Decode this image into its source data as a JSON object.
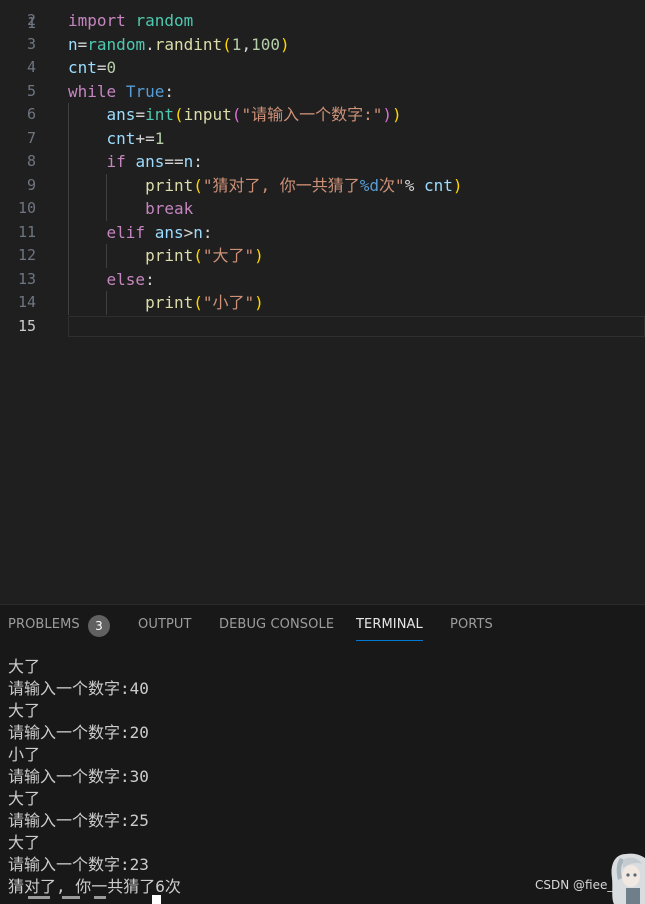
{
  "editor": {
    "top_line_number": "1",
    "active_line": "15",
    "lines": [
      {
        "num": "2",
        "tokens": [
          [
            "kw-ctl",
            "import"
          ],
          [
            "op",
            " "
          ],
          [
            "mod",
            "random"
          ]
        ]
      },
      {
        "num": "3",
        "tokens": [
          [
            "var",
            "n"
          ],
          [
            "op",
            "="
          ],
          [
            "mod",
            "random"
          ],
          [
            "op",
            "."
          ],
          [
            "fn",
            "randint"
          ],
          [
            "p1",
            "("
          ],
          [
            "num",
            "1"
          ],
          [
            "op",
            ","
          ],
          [
            "num",
            "100"
          ],
          [
            "p1",
            ")"
          ]
        ]
      },
      {
        "num": "4",
        "tokens": [
          [
            "var",
            "cnt"
          ],
          [
            "op",
            "="
          ],
          [
            "num",
            "0"
          ]
        ]
      },
      {
        "num": "5",
        "tokens": [
          [
            "kw-ctl",
            "while"
          ],
          [
            "op",
            " "
          ],
          [
            "kw",
            "True"
          ],
          [
            "op",
            ":"
          ]
        ]
      },
      {
        "num": "6",
        "tokens": [
          [
            "op",
            "    "
          ],
          [
            "var",
            "ans"
          ],
          [
            "op",
            "="
          ],
          [
            "mod",
            "int"
          ],
          [
            "p1",
            "("
          ],
          [
            "fn",
            "input"
          ],
          [
            "p2",
            "("
          ],
          [
            "str",
            "\"请输入一个数字:\""
          ],
          [
            "p2",
            ")"
          ],
          [
            "p1",
            ")"
          ]
        ]
      },
      {
        "num": "7",
        "tokens": [
          [
            "op",
            "    "
          ],
          [
            "var",
            "cnt"
          ],
          [
            "op",
            "+="
          ],
          [
            "num",
            "1"
          ]
        ]
      },
      {
        "num": "8",
        "tokens": [
          [
            "op",
            "    "
          ],
          [
            "kw-ctl",
            "if"
          ],
          [
            "op",
            " "
          ],
          [
            "var",
            "ans"
          ],
          [
            "op",
            "=="
          ],
          [
            "var",
            "n"
          ],
          [
            "op",
            ":"
          ]
        ]
      },
      {
        "num": "9",
        "tokens": [
          [
            "op",
            "        "
          ],
          [
            "fn",
            "print"
          ],
          [
            "p1",
            "("
          ],
          [
            "str",
            "\"猜对了, 你一共猜了"
          ],
          [
            "fmt",
            "%d"
          ],
          [
            "str",
            "次\""
          ],
          [
            "op",
            "% "
          ],
          [
            "var",
            "cnt"
          ],
          [
            "p1",
            ")"
          ]
        ]
      },
      {
        "num": "10",
        "tokens": [
          [
            "op",
            "        "
          ],
          [
            "kw-ctl",
            "break"
          ]
        ]
      },
      {
        "num": "11",
        "tokens": [
          [
            "op",
            "    "
          ],
          [
            "kw-ctl",
            "elif"
          ],
          [
            "op",
            " "
          ],
          [
            "var",
            "ans"
          ],
          [
            "op",
            ">"
          ],
          [
            "var",
            "n"
          ],
          [
            "op",
            ":"
          ]
        ]
      },
      {
        "num": "12",
        "tokens": [
          [
            "op",
            "        "
          ],
          [
            "fn",
            "print"
          ],
          [
            "p1",
            "("
          ],
          [
            "str",
            "\"大了\""
          ],
          [
            "p1",
            ")"
          ]
        ]
      },
      {
        "num": "13",
        "tokens": [
          [
            "op",
            "    "
          ],
          [
            "kw-ctl",
            "else"
          ],
          [
            "op",
            ":"
          ]
        ]
      },
      {
        "num": "14",
        "tokens": [
          [
            "op",
            "        "
          ],
          [
            "fn",
            "print"
          ],
          [
            "p1",
            "("
          ],
          [
            "str",
            "\"小了\""
          ],
          [
            "p1",
            ")"
          ]
        ]
      },
      {
        "num": "15",
        "tokens": []
      }
    ]
  },
  "panel": {
    "tabs": {
      "problems": "PROBLEMS",
      "problems_count": "3",
      "output": "OUTPUT",
      "debug_console": "DEBUG CONSOLE",
      "terminal": "TERMINAL",
      "ports": "PORTS"
    },
    "active_tab": "TERMINAL",
    "terminal_lines": [
      "大了",
      "请输入一个数字:40",
      "大了",
      "请输入一个数字:20",
      "小了",
      "请输入一个数字:30",
      "大了",
      "请输入一个数字:25",
      "大了",
      "请输入一个数字:23",
      "猜对了, 你一共猜了6次"
    ]
  },
  "watermark": "CSDN @fiee_liu",
  "colors": {
    "editor_bg": "#1f1f1f",
    "panel_bg": "#181818",
    "keyword_control": "#c586c0",
    "keyword": "#569cd6",
    "variable": "#9cdcfe",
    "function": "#dcdcaa",
    "module": "#4ec9b0",
    "number": "#b5cea8",
    "string": "#ce9178",
    "accent": "#0078d4"
  }
}
